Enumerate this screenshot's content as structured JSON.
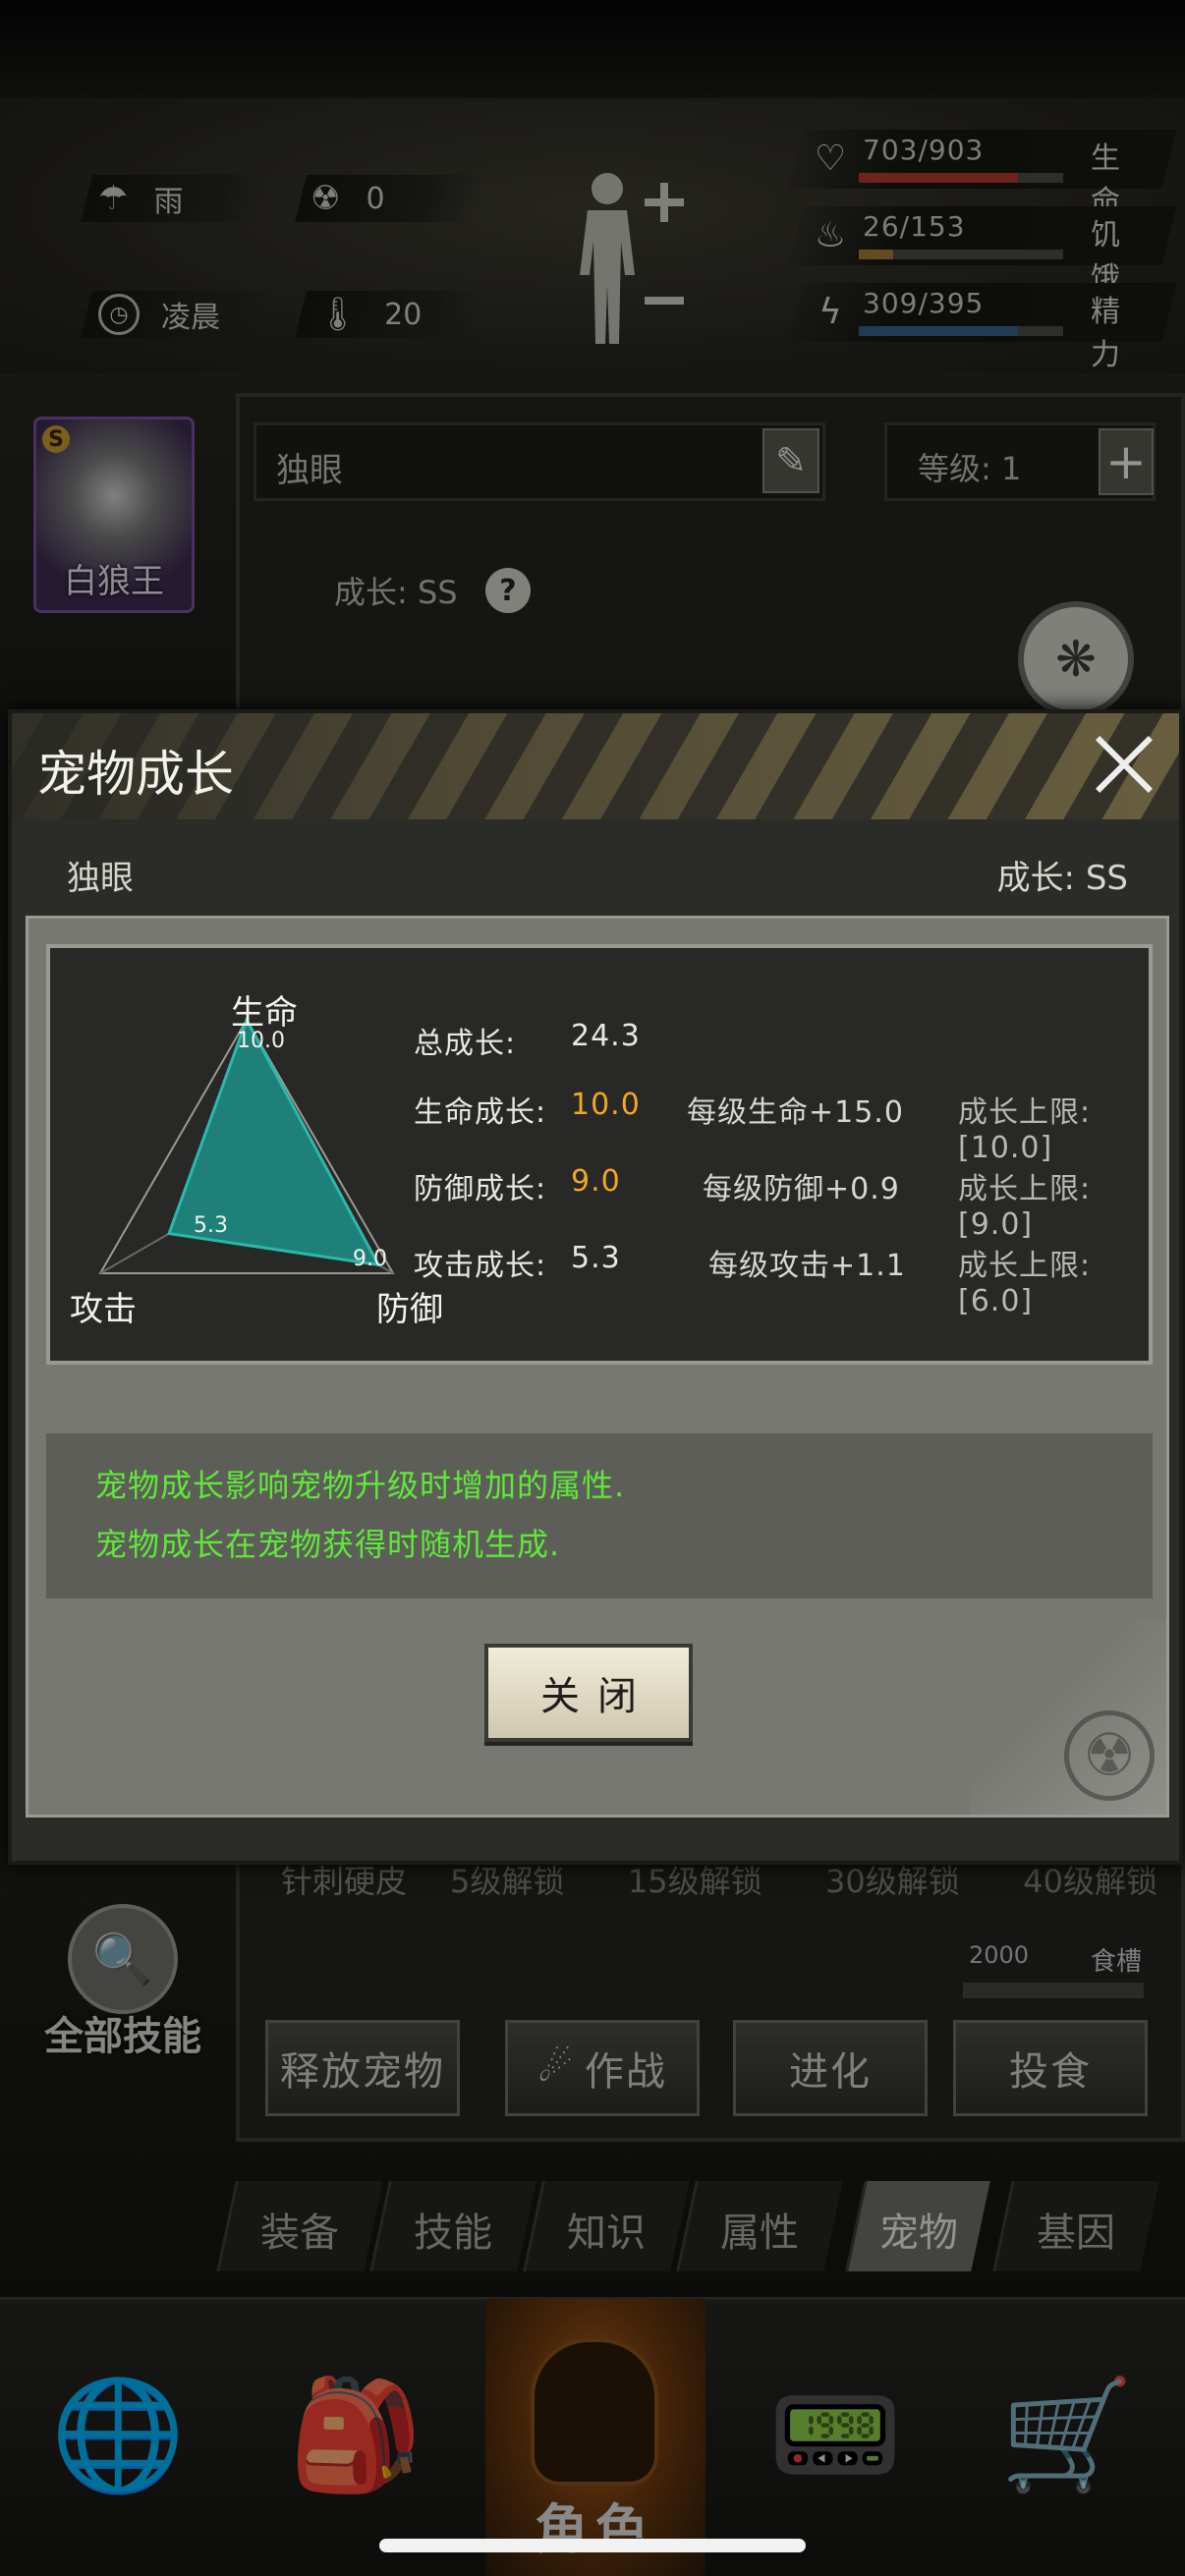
{
  "status": {
    "weather": {
      "icon": "rain-cloud-icon",
      "value": "雨"
    },
    "radiation": {
      "icon": "radiation-icon",
      "value": "0"
    },
    "time": {
      "icon": "clock-icon",
      "value": "凌晨"
    },
    "temperature": {
      "icon": "thermometer-icon",
      "value": "20"
    },
    "bars": [
      {
        "key": "life",
        "icon": "heart-icon",
        "value": "703/903",
        "label": "生命",
        "fraction": 0.78,
        "color": "#b03a2e"
      },
      {
        "key": "hunger",
        "icon": "stomach-icon",
        "value": "26/153",
        "label": "饥饿",
        "fraction": 0.17,
        "color": "#a07a3a"
      },
      {
        "key": "energy",
        "icon": "lightning-head-icon",
        "value": "309/395",
        "label": "精力",
        "fraction": 0.78,
        "color": "#3a5f8a"
      }
    ]
  },
  "pet": {
    "avatar_name": "白狼王",
    "avatar_rank": "S",
    "name": "独眼",
    "level_text": "等级: 1",
    "growth_text": "成长: SS",
    "icon_number_label": "生命",
    "icon_number": "10.0"
  },
  "unlock_row": {
    "left": "针刺硬皮",
    "items": [
      "5级解锁",
      "15级解锁",
      "30级解锁",
      "40级解锁"
    ]
  },
  "food": {
    "value": "2000",
    "label": "食槽"
  },
  "all_skills_label": "全部技能",
  "actions": [
    "释放宠物",
    "作战",
    "进化",
    "投食"
  ],
  "tabs": [
    {
      "label": "装备",
      "active": false
    },
    {
      "label": "技能",
      "active": false
    },
    {
      "label": "知识",
      "active": false
    },
    {
      "label": "属性",
      "active": false
    },
    {
      "label": "宠物",
      "active": true
    },
    {
      "label": "基因",
      "active": false
    }
  ],
  "nav": {
    "items": [
      "globe-icon",
      "backpack-icon",
      "character-icon",
      "walkie-talkie-icon",
      "shopping-cart-icon"
    ],
    "center_label": "角色"
  },
  "dialog": {
    "title": "宠物成长",
    "pet_name": "独眼",
    "pet_growth": "成长: SS",
    "total_label": "总成长:",
    "total_value": "24.3",
    "rows": [
      {
        "label": "生命成长:",
        "value": "10.0",
        "per_level": "每级生命+15.0",
        "cap": "成长上限:[10.0]",
        "highlight": true
      },
      {
        "label": "防御成长:",
        "value": "9.0",
        "per_level": "每级防御+0.9",
        "cap": "成长上限:[9.0]",
        "highlight": true
      },
      {
        "label": "攻击成长:",
        "value": "5.3",
        "per_level": "每级攻击+1.1",
        "cap": "成长上限:[6.0]",
        "highlight": false
      }
    ],
    "radar": {
      "axes": [
        {
          "label": "生命",
          "value": 10.0,
          "value_text": "10.0"
        },
        {
          "label": "防御",
          "value": 9.0,
          "value_text": "9.0"
        },
        {
          "label": "攻击",
          "value": 5.3,
          "value_text": "5.3"
        }
      ],
      "max": 10
    },
    "info_lines": [
      "宠物成长影响宠物升级时增加的属性.",
      "宠物成长在宠物获得时随机生成."
    ],
    "close_label": "关闭"
  },
  "colors": {
    "highlight": "#f0a826",
    "info_text": "#5fe83a",
    "radar_fill": "#1f8079",
    "radar_stroke": "#2bb8ad"
  }
}
